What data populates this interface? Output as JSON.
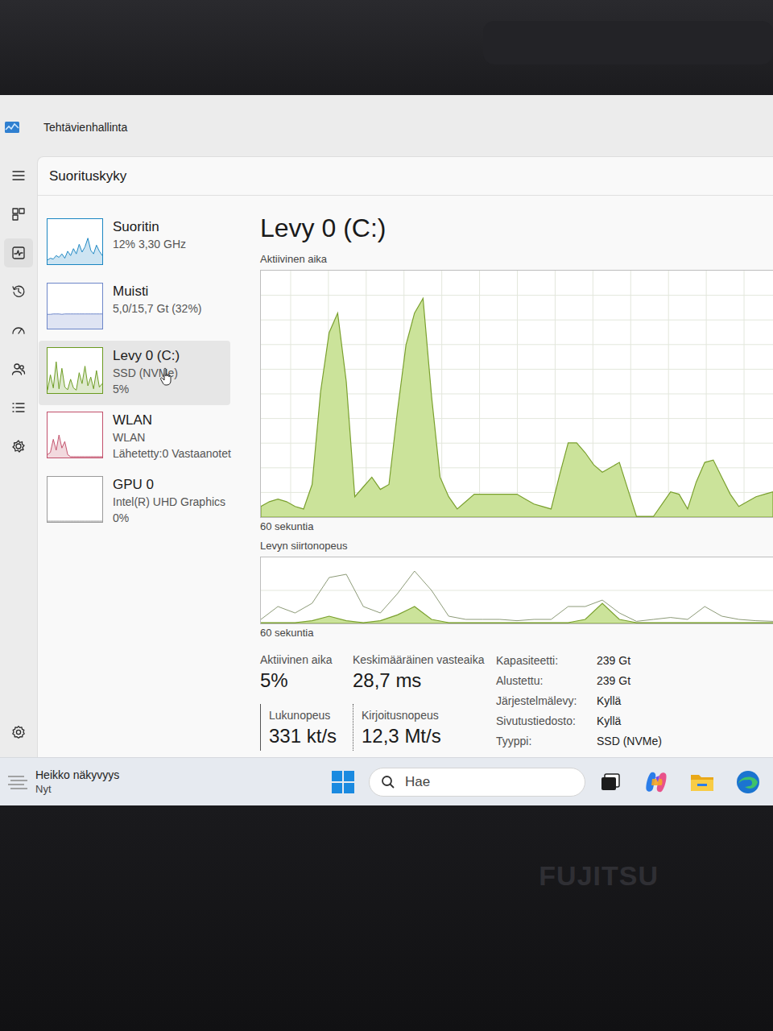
{
  "window": {
    "title": "Tehtävienhallinta"
  },
  "nav": {
    "items": [
      {
        "selected": false
      },
      {
        "selected": true
      },
      {
        "selected": false
      },
      {
        "selected": false
      },
      {
        "selected": false
      },
      {
        "selected": false
      },
      {
        "selected": false
      }
    ],
    "settings": {
      "selected": false
    }
  },
  "page": {
    "title": "Suorituskyky"
  },
  "sidebar": {
    "items": [
      {
        "name": "Suoritin",
        "details": [
          "12% 3,30 GHz"
        ],
        "selected": false,
        "color": "#1b86c2",
        "values": [
          8,
          12,
          10,
          18,
          14,
          22,
          12,
          28,
          18,
          34,
          22,
          44,
          26,
          38,
          58,
          30,
          22,
          42,
          28,
          18
        ]
      },
      {
        "name": "Muisti",
        "details": [
          "5,0/15,7 Gt (32%)"
        ],
        "selected": false,
        "color": "#6d86c9",
        "values": [
          31,
          31,
          32,
          32,
          32,
          31,
          32,
          32,
          32,
          32,
          32,
          32,
          32,
          32,
          32,
          32,
          32,
          32,
          32,
          32
        ]
      },
      {
        "name": "Levy 0 (C:)",
        "details": [
          "SSD (NVMe)",
          "5%"
        ],
        "selected": true,
        "color": "#6a9a1f",
        "values": [
          5,
          40,
          10,
          70,
          8,
          55,
          12,
          6,
          30,
          10,
          5,
          45,
          20,
          60,
          15,
          35,
          8,
          50,
          12,
          20
        ]
      },
      {
        "name": "WLAN",
        "details": [
          "WLAN",
          "Lähetetty:0 Vastaanotet"
        ],
        "selected": false,
        "color": "#c2506b",
        "values": [
          5,
          10,
          40,
          15,
          50,
          20,
          35,
          5,
          0,
          0,
          0,
          0,
          0,
          0,
          0,
          0,
          0,
          0,
          0,
          0
        ]
      },
      {
        "name": "GPU 0",
        "details": [
          "Intel(R) UHD Graphics",
          "0%"
        ],
        "selected": false,
        "color": "#9a9a9a",
        "values": [
          0,
          0,
          0,
          0,
          0,
          0,
          0,
          0,
          0,
          0,
          0,
          0,
          0,
          0,
          0,
          0,
          0,
          0,
          0,
          0
        ]
      }
    ]
  },
  "detail": {
    "title": "Levy 0 (C:)",
    "active_chart": {
      "label": "Aktiivinen aika",
      "axis": "60 sekuntia",
      "values": [
        4,
        6,
        7,
        6,
        4,
        3,
        13,
        51,
        75,
        83,
        55,
        8,
        12,
        16,
        11,
        13,
        43,
        70,
        83,
        89,
        49,
        16,
        8,
        3,
        6,
        9,
        9,
        9,
        9,
        9,
        9,
        7,
        5,
        4,
        3,
        17,
        30,
        30,
        26,
        21,
        18,
        20,
        22,
        11,
        0,
        0,
        0,
        5,
        10,
        9,
        3,
        14,
        22,
        23,
        16,
        9,
        4,
        6,
        8,
        9,
        10
      ]
    },
    "transfer_chart": {
      "label": "Levyn siirtonopeus",
      "axis": "60 sekuntia",
      "series": [
        {
          "kind": "line",
          "values": [
            5,
            25,
            15,
            30,
            70,
            75,
            25,
            15,
            45,
            80,
            50,
            10,
            5,
            5,
            5,
            3,
            5,
            5,
            25,
            25,
            35,
            15,
            2,
            5,
            8,
            5,
            25,
            10,
            5,
            3,
            2
          ]
        },
        {
          "kind": "area",
          "values": [
            0,
            0,
            0,
            3,
            10,
            3,
            0,
            3,
            12,
            25,
            5,
            0,
            0,
            0,
            0,
            0,
            0,
            0,
            0,
            5,
            30,
            5,
            0,
            0,
            0,
            0,
            0,
            0,
            0,
            0,
            0
          ]
        }
      ]
    },
    "stats": [
      {
        "label": "Aktiivinen aika",
        "value": "5%",
        "kind": "plain"
      },
      {
        "label": "Keskimääräinen vasteaika",
        "value": "28,7 ms",
        "kind": "plain"
      },
      {
        "label": "Lukunopeus",
        "value": "331 kt/s",
        "kind": "read"
      },
      {
        "label": "Kirjoitusnopeus",
        "value": "12,3 Mt/s",
        "kind": "write"
      }
    ],
    "properties": [
      {
        "label": "Kapasiteetti:",
        "value": "239 Gt"
      },
      {
        "label": "Alustettu:",
        "value": "239 Gt"
      },
      {
        "label": "Järjestelmälevy:",
        "value": "Kyllä"
      },
      {
        "label": "Sivutustiedosto:",
        "value": "Kyllä"
      },
      {
        "label": "Tyyppi:",
        "value": "SSD (NVMe)"
      }
    ]
  },
  "taskbar": {
    "weather": {
      "title": "Heikko näkyvyys",
      "time": "Nyt"
    },
    "search": {
      "placeholder": "Hae"
    }
  },
  "device": {
    "logo": "FUJITSU"
  }
}
